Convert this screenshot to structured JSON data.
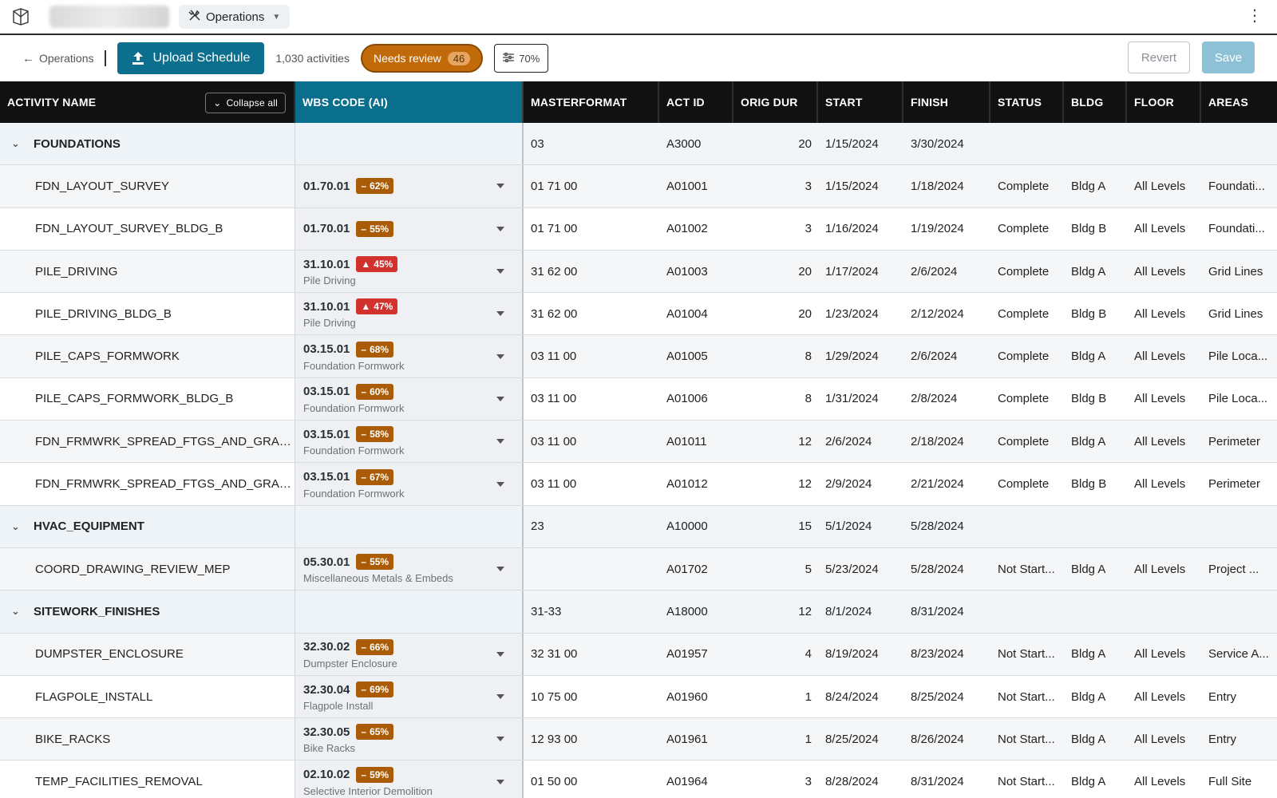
{
  "topbar": {
    "project_menu": "Operations"
  },
  "toolbar": {
    "back_label": "Operations",
    "upload_label": "Upload Schedule",
    "activity_count": "1,030 activities",
    "needs_review_label": "Needs review",
    "needs_review_count": "46",
    "filter_value": "70%",
    "revert_label": "Revert",
    "save_label": "Save"
  },
  "columns": {
    "name": "ACTIVITY NAME",
    "collapse": "Collapse all",
    "wbs": "WBS CODE (AI)",
    "masterformat": "MASTERFORMAT",
    "act_id": "ACT ID",
    "orig_dur": "ORIG DUR",
    "start": "START",
    "finish": "FINISH",
    "status": "STATUS",
    "bldg": "BLDG",
    "floor": "FLOOR",
    "areas": "AREAS"
  },
  "rows": [
    {
      "group": true,
      "name": "FOUNDATIONS",
      "mf": "03",
      "id": "A3000",
      "dur": "20",
      "start": "1/15/2024",
      "finish": "3/30/2024"
    },
    {
      "name": "FDN_LAYOUT_SURVEY",
      "wbs": "01.70.01",
      "conf": "62%",
      "level": "med",
      "sub": "",
      "mf": "01 71 00",
      "id": "A01001",
      "dur": "3",
      "start": "1/15/2024",
      "finish": "1/18/2024",
      "status": "Complete",
      "bldg": "Bldg A",
      "floor": "All Levels",
      "areas": "Foundati..."
    },
    {
      "name": "FDN_LAYOUT_SURVEY_BLDG_B",
      "wbs": "01.70.01",
      "conf": "55%",
      "level": "med",
      "sub": "",
      "mf": "01 71 00",
      "id": "A01002",
      "dur": "3",
      "start": "1/16/2024",
      "finish": "1/19/2024",
      "status": "Complete",
      "bldg": "Bldg B",
      "floor": "All Levels",
      "areas": "Foundati..."
    },
    {
      "name": "PILE_DRIVING",
      "wbs": "31.10.01",
      "conf": "45%",
      "level": "low",
      "sub": "Pile Driving",
      "mf": "31 62 00",
      "id": "A01003",
      "dur": "20",
      "start": "1/17/2024",
      "finish": "2/6/2024",
      "status": "Complete",
      "bldg": "Bldg A",
      "floor": "All Levels",
      "areas": "Grid Lines"
    },
    {
      "name": "PILE_DRIVING_BLDG_B",
      "wbs": "31.10.01",
      "conf": "47%",
      "level": "low",
      "sub": "Pile Driving",
      "mf": "31 62 00",
      "id": "A01004",
      "dur": "20",
      "start": "1/23/2024",
      "finish": "2/12/2024",
      "status": "Complete",
      "bldg": "Bldg B",
      "floor": "All Levels",
      "areas": "Grid Lines"
    },
    {
      "name": "PILE_CAPS_FORMWORK",
      "wbs": "03.15.01",
      "conf": "68%",
      "level": "med",
      "sub": "Foundation Formwork",
      "mf": "03 11 00",
      "id": "A01005",
      "dur": "8",
      "start": "1/29/2024",
      "finish": "2/6/2024",
      "status": "Complete",
      "bldg": "Bldg A",
      "floor": "All Levels",
      "areas": "Pile Loca..."
    },
    {
      "name": "PILE_CAPS_FORMWORK_BLDG_B",
      "wbs": "03.15.01",
      "conf": "60%",
      "level": "med",
      "sub": "Foundation Formwork",
      "mf": "03 11 00",
      "id": "A01006",
      "dur": "8",
      "start": "1/31/2024",
      "finish": "2/8/2024",
      "status": "Complete",
      "bldg": "Bldg B",
      "floor": "All Levels",
      "areas": "Pile Loca..."
    },
    {
      "name": "FDN_FRMWRK_SPREAD_FTGS_AND_GRAD...",
      "wbs": "03.15.01",
      "conf": "58%",
      "level": "med",
      "sub": "Foundation Formwork",
      "mf": "03 11 00",
      "id": "A01011",
      "dur": "12",
      "start": "2/6/2024",
      "finish": "2/18/2024",
      "status": "Complete",
      "bldg": "Bldg A",
      "floor": "All Levels",
      "areas": "Perimeter"
    },
    {
      "name": "FDN_FRMWRK_SPREAD_FTGS_AND_GRAD...",
      "wbs": "03.15.01",
      "conf": "67%",
      "level": "med",
      "sub": "Foundation Formwork",
      "mf": "03 11 00",
      "id": "A01012",
      "dur": "12",
      "start": "2/9/2024",
      "finish": "2/21/2024",
      "status": "Complete",
      "bldg": "Bldg B",
      "floor": "All Levels",
      "areas": "Perimeter"
    },
    {
      "group": true,
      "name": "HVAC_EQUIPMENT",
      "mf": "23",
      "id": "A10000",
      "dur": "15",
      "start": "5/1/2024",
      "finish": "5/28/2024"
    },
    {
      "name": "COORD_DRAWING_REVIEW_MEP",
      "wbs": "05.30.01",
      "conf": "55%",
      "level": "med",
      "sub": "Miscellaneous Metals & Embeds",
      "mf": "",
      "id": "A01702",
      "dur": "5",
      "start": "5/23/2024",
      "finish": "5/28/2024",
      "status": "Not Start...",
      "bldg": "Bldg A",
      "floor": "All Levels",
      "areas": "Project ..."
    },
    {
      "group": true,
      "name": "SITEWORK_FINISHES",
      "mf": "31-33",
      "id": "A18000",
      "dur": "12",
      "start": "8/1/2024",
      "finish": "8/31/2024"
    },
    {
      "name": "DUMPSTER_ENCLOSURE",
      "wbs": "32.30.02",
      "conf": "66%",
      "level": "med",
      "sub": "Dumpster Enclosure",
      "mf": "32 31 00",
      "id": "A01957",
      "dur": "4",
      "start": "8/19/2024",
      "finish": "8/23/2024",
      "status": "Not Start...",
      "bldg": "Bldg A",
      "floor": "All Levels",
      "areas": "Service A..."
    },
    {
      "name": "FLAGPOLE_INSTALL",
      "wbs": "32.30.04",
      "conf": "69%",
      "level": "med",
      "sub": "Flagpole Install",
      "mf": "10 75 00",
      "id": "A01960",
      "dur": "1",
      "start": "8/24/2024",
      "finish": "8/25/2024",
      "status": "Not Start...",
      "bldg": "Bldg A",
      "floor": "All Levels",
      "areas": "Entry"
    },
    {
      "name": "BIKE_RACKS",
      "wbs": "32.30.05",
      "conf": "65%",
      "level": "med",
      "sub": "Bike Racks",
      "mf": "12 93 00",
      "id": "A01961",
      "dur": "1",
      "start": "8/25/2024",
      "finish": "8/26/2024",
      "status": "Not Start...",
      "bldg": "Bldg A",
      "floor": "All Levels",
      "areas": "Entry"
    },
    {
      "name": "TEMP_FACILITIES_REMOVAL",
      "wbs": "02.10.02",
      "conf": "59%",
      "level": "med",
      "sub": "Selective Interior Demolition",
      "mf": "01 50 00",
      "id": "A01964",
      "dur": "3",
      "start": "8/28/2024",
      "finish": "8/31/2024",
      "status": "Not Start...",
      "bldg": "Bldg A",
      "floor": "All Levels",
      "areas": "Full Site"
    }
  ]
}
